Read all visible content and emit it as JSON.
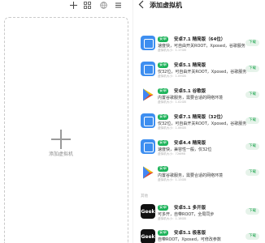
{
  "left_pane": {
    "toolbar_icons": [
      "plus-icon",
      "grid-icon",
      "globe-icon",
      "more-icon"
    ],
    "add_label": "添加虚拟机"
  },
  "right_pane": {
    "title": "添加虚拟机",
    "items": [
      {
        "icon": "app-icon",
        "badge": "安卓",
        "name": "安卓7.1 精简版（64位）",
        "desc": "速度快，可自由开关ROOT，Xposed，谷歌服务",
        "meta": "虚拟机大小：1.17GB",
        "action": "下载"
      },
      {
        "icon": "app-icon",
        "badge": "安卓",
        "name": "安卓5.1 精简版",
        "desc": "仅32位，可自由开关ROOT，Xposed，谷歌服务",
        "meta": "虚拟机大小：1.09GB",
        "action": "下载"
      },
      {
        "icon": "play-icon",
        "badge": "安卓",
        "name": "安卓5.1 谷歌版",
        "desc": "内置谷歌服务，需要合适的网络环境",
        "meta": "虚拟机大小：1.02GB",
        "action": "下载"
      },
      {
        "icon": "app-icon",
        "badge": "安卓",
        "name": "安卓7.1 精简版（32位）",
        "desc": "仅32位，可自由开关ROOT，Xposed，谷歌服务",
        "meta": "虚拟机大小：1.06GB",
        "action": "下载"
      },
      {
        "icon": "app-icon",
        "badge": "安卓",
        "name": "安卓4.4 精简版",
        "desc": "速度快，兼容性一般，仅32位",
        "meta": "虚拟机大小：726MB",
        "action": "下载"
      },
      {
        "icon": "play-icon",
        "badge": "安卓",
        "name": "",
        "desc": "内置谷歌服务，需要合适的网络环境",
        "meta": "虚拟机大小：1.13GB",
        "action": "下载"
      }
    ],
    "section2_label": "其他",
    "items2": [
      {
        "icon": "geek-icon",
        "icon_text": "Geek",
        "badge": "安卓",
        "name": "安卓5.1 多开版",
        "desc": "可多开，自带ROOT，全局同步",
        "meta": "虚拟机大小：1.18GB",
        "action": "下载"
      },
      {
        "icon": "geek-icon",
        "icon_text": "Geek",
        "badge": "安卓",
        "name": "安卓5.1 极客版",
        "desc": "自带ROOT，Xposed，可修改参数",
        "meta": "",
        "action": "下载"
      }
    ]
  },
  "colors": {
    "accent_green": "#1db35a",
    "download_bg": "#e6f3ea",
    "blue_icon": "#3d8ef0"
  }
}
